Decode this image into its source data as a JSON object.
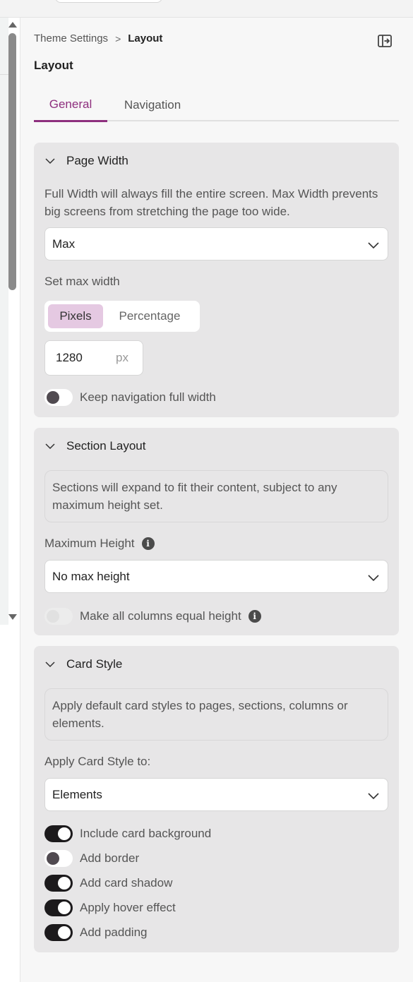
{
  "breadcrumb": {
    "parent": "Theme Settings",
    "current": "Layout",
    "separator": ">"
  },
  "page_title": "Layout",
  "tabs": [
    {
      "label": "General",
      "active": true
    },
    {
      "label": "Navigation",
      "active": false
    }
  ],
  "page_width": {
    "title": "Page Width",
    "description": "Full Width will always fill the entire screen. Max Width prevents big screens from stretching the page too wide.",
    "mode_value": "Max",
    "max_width_label": "Set max width",
    "unit_options": [
      "Pixels",
      "Percentage"
    ],
    "selected_unit": "Pixels",
    "max_width_value": "1280",
    "max_width_unit": "px",
    "keep_nav_full_width": {
      "label": "Keep navigation full width",
      "on": false
    }
  },
  "section_layout": {
    "title": "Section Layout",
    "info": "Sections will expand to fit their content, subject to any maximum height set.",
    "max_height_label": "Maximum Height",
    "max_height_value": "No max height",
    "equal_height": {
      "label": "Make all columns equal height",
      "on": false,
      "disabled": true
    }
  },
  "card_style": {
    "title": "Card Style",
    "info": "Apply default card styles to pages, sections, columns or elements.",
    "apply_to_label": "Apply Card Style to:",
    "apply_to_value": "Elements",
    "toggles": [
      {
        "label": "Include card background",
        "on": true
      },
      {
        "label": "Add border",
        "on": false
      },
      {
        "label": "Add card shadow",
        "on": true
      },
      {
        "label": "Apply hover effect",
        "on": true
      },
      {
        "label": "Add padding",
        "on": true
      }
    ]
  },
  "colors": {
    "accent": "#8e2f7e",
    "segment_selected": "#e5c9e2",
    "toggle_on": "#1c1a1c",
    "card_bg": "#e7e6e7"
  }
}
